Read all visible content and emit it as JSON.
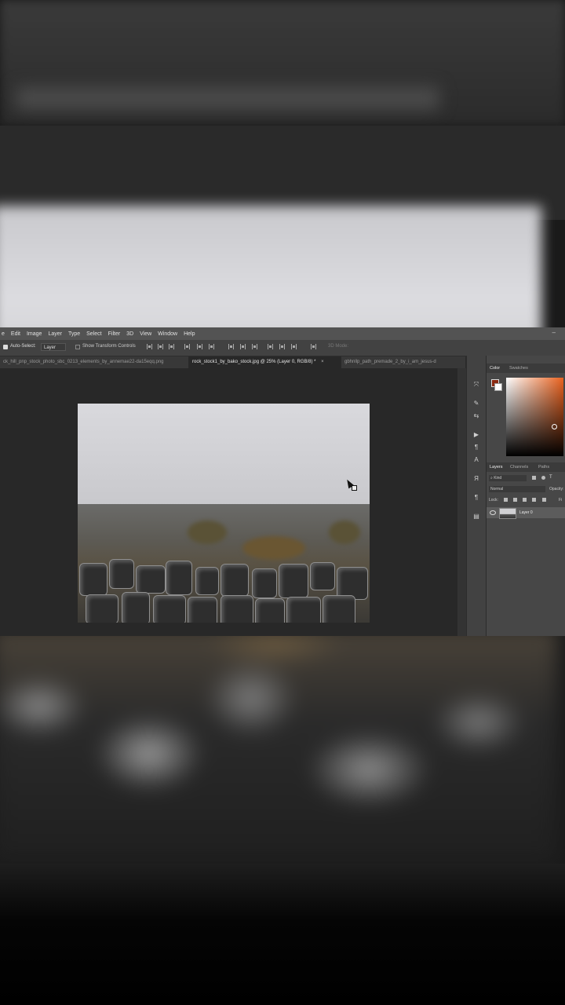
{
  "menu": [
    "e",
    "Edit",
    "Image",
    "Layer",
    "Type",
    "Select",
    "Filter",
    "3D",
    "View",
    "Window",
    "Help"
  ],
  "options": {
    "auto_select_label": "Auto-Select:",
    "layer_select_value": "Layer",
    "show_transform_label": "Show Transform Controls",
    "mode_3d_label": "3D Mode:"
  },
  "tabs": [
    {
      "label": "ck_hill_pnp_stock_photo_sbc_0213_elements_by_annemae22-da15eqq.png",
      "active": false
    },
    {
      "label": "rock_stock1_by_bako_stock.jpg @ 25% (Layer 0, RGB/8) *",
      "active": true
    },
    {
      "label": "gbhnllp_path_premade_2_by_i_am_jesus-d",
      "active": false
    }
  ],
  "panels": {
    "color_tabs": [
      "Color",
      "Swatches"
    ],
    "layers_tabs": [
      "Layers",
      "Channels",
      "Paths"
    ],
    "filter_kind": "Kind",
    "blend_mode": "Normal",
    "opacity_label": "Opacity:",
    "lock_label": "Lock:",
    "fill_label": "Fi",
    "layer_name": "Layer 0"
  },
  "colors": {
    "foreground": "#8a2a12",
    "background": "#ffffff",
    "picker_hue": "#e9621f"
  },
  "tool_icons": [
    "move-icon",
    "brush-icon",
    "adjust-icon",
    "play-icon",
    "character-icon",
    "paragraph-icon",
    "glyph-icon",
    "paragraph-mark-icon",
    "properties-icon"
  ]
}
